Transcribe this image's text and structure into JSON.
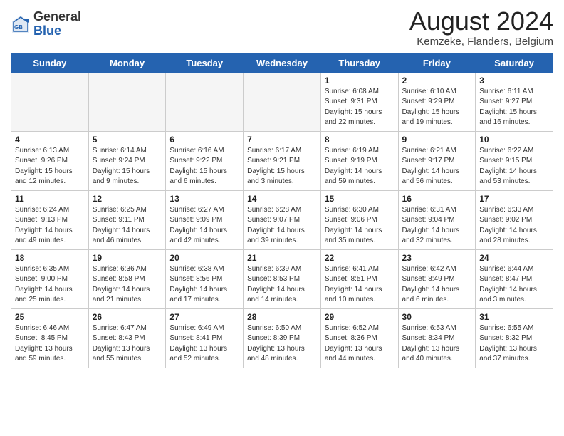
{
  "header": {
    "logo_general": "General",
    "logo_blue": "Blue",
    "month_title": "August 2024",
    "location": "Kemzeke, Flanders, Belgium"
  },
  "weekdays": [
    "Sunday",
    "Monday",
    "Tuesday",
    "Wednesday",
    "Thursday",
    "Friday",
    "Saturday"
  ],
  "weeks": [
    [
      {
        "day": "",
        "info": ""
      },
      {
        "day": "",
        "info": ""
      },
      {
        "day": "",
        "info": ""
      },
      {
        "day": "",
        "info": ""
      },
      {
        "day": "1",
        "info": "Sunrise: 6:08 AM\nSunset: 9:31 PM\nDaylight: 15 hours\nand 22 minutes."
      },
      {
        "day": "2",
        "info": "Sunrise: 6:10 AM\nSunset: 9:29 PM\nDaylight: 15 hours\nand 19 minutes."
      },
      {
        "day": "3",
        "info": "Sunrise: 6:11 AM\nSunset: 9:27 PM\nDaylight: 15 hours\nand 16 minutes."
      }
    ],
    [
      {
        "day": "4",
        "info": "Sunrise: 6:13 AM\nSunset: 9:26 PM\nDaylight: 15 hours\nand 12 minutes."
      },
      {
        "day": "5",
        "info": "Sunrise: 6:14 AM\nSunset: 9:24 PM\nDaylight: 15 hours\nand 9 minutes."
      },
      {
        "day": "6",
        "info": "Sunrise: 6:16 AM\nSunset: 9:22 PM\nDaylight: 15 hours\nand 6 minutes."
      },
      {
        "day": "7",
        "info": "Sunrise: 6:17 AM\nSunset: 9:21 PM\nDaylight: 15 hours\nand 3 minutes."
      },
      {
        "day": "8",
        "info": "Sunrise: 6:19 AM\nSunset: 9:19 PM\nDaylight: 14 hours\nand 59 minutes."
      },
      {
        "day": "9",
        "info": "Sunrise: 6:21 AM\nSunset: 9:17 PM\nDaylight: 14 hours\nand 56 minutes."
      },
      {
        "day": "10",
        "info": "Sunrise: 6:22 AM\nSunset: 9:15 PM\nDaylight: 14 hours\nand 53 minutes."
      }
    ],
    [
      {
        "day": "11",
        "info": "Sunrise: 6:24 AM\nSunset: 9:13 PM\nDaylight: 14 hours\nand 49 minutes."
      },
      {
        "day": "12",
        "info": "Sunrise: 6:25 AM\nSunset: 9:11 PM\nDaylight: 14 hours\nand 46 minutes."
      },
      {
        "day": "13",
        "info": "Sunrise: 6:27 AM\nSunset: 9:09 PM\nDaylight: 14 hours\nand 42 minutes."
      },
      {
        "day": "14",
        "info": "Sunrise: 6:28 AM\nSunset: 9:07 PM\nDaylight: 14 hours\nand 39 minutes."
      },
      {
        "day": "15",
        "info": "Sunrise: 6:30 AM\nSunset: 9:06 PM\nDaylight: 14 hours\nand 35 minutes."
      },
      {
        "day": "16",
        "info": "Sunrise: 6:31 AM\nSunset: 9:04 PM\nDaylight: 14 hours\nand 32 minutes."
      },
      {
        "day": "17",
        "info": "Sunrise: 6:33 AM\nSunset: 9:02 PM\nDaylight: 14 hours\nand 28 minutes."
      }
    ],
    [
      {
        "day": "18",
        "info": "Sunrise: 6:35 AM\nSunset: 9:00 PM\nDaylight: 14 hours\nand 25 minutes."
      },
      {
        "day": "19",
        "info": "Sunrise: 6:36 AM\nSunset: 8:58 PM\nDaylight: 14 hours\nand 21 minutes."
      },
      {
        "day": "20",
        "info": "Sunrise: 6:38 AM\nSunset: 8:56 PM\nDaylight: 14 hours\nand 17 minutes."
      },
      {
        "day": "21",
        "info": "Sunrise: 6:39 AM\nSunset: 8:53 PM\nDaylight: 14 hours\nand 14 minutes."
      },
      {
        "day": "22",
        "info": "Sunrise: 6:41 AM\nSunset: 8:51 PM\nDaylight: 14 hours\nand 10 minutes."
      },
      {
        "day": "23",
        "info": "Sunrise: 6:42 AM\nSunset: 8:49 PM\nDaylight: 14 hours\nand 6 minutes."
      },
      {
        "day": "24",
        "info": "Sunrise: 6:44 AM\nSunset: 8:47 PM\nDaylight: 14 hours\nand 3 minutes."
      }
    ],
    [
      {
        "day": "25",
        "info": "Sunrise: 6:46 AM\nSunset: 8:45 PM\nDaylight: 13 hours\nand 59 minutes."
      },
      {
        "day": "26",
        "info": "Sunrise: 6:47 AM\nSunset: 8:43 PM\nDaylight: 13 hours\nand 55 minutes."
      },
      {
        "day": "27",
        "info": "Sunrise: 6:49 AM\nSunset: 8:41 PM\nDaylight: 13 hours\nand 52 minutes."
      },
      {
        "day": "28",
        "info": "Sunrise: 6:50 AM\nSunset: 8:39 PM\nDaylight: 13 hours\nand 48 minutes."
      },
      {
        "day": "29",
        "info": "Sunrise: 6:52 AM\nSunset: 8:36 PM\nDaylight: 13 hours\nand 44 minutes."
      },
      {
        "day": "30",
        "info": "Sunrise: 6:53 AM\nSunset: 8:34 PM\nDaylight: 13 hours\nand 40 minutes."
      },
      {
        "day": "31",
        "info": "Sunrise: 6:55 AM\nSunset: 8:32 PM\nDaylight: 13 hours\nand 37 minutes."
      }
    ]
  ]
}
